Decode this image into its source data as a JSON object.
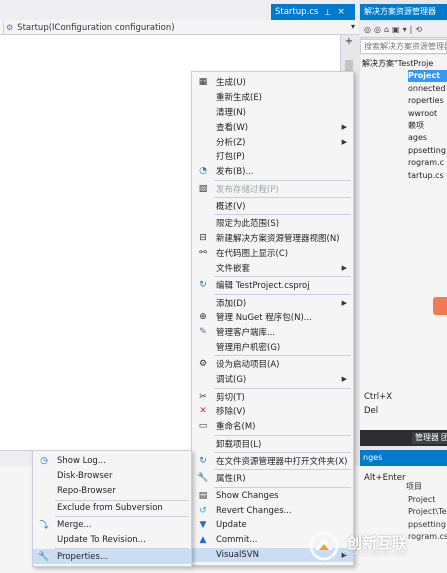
{
  "editor": {
    "tab_label": "Startup.cs",
    "tab_pin": "⊥",
    "tab_close": "×",
    "tab_dropdown": "▾",
    "method_icon": "⚙",
    "method_combo": "Startup(IConfiguration configuration)",
    "split_button": "+"
  },
  "solution_explorer": {
    "title": "解决方案资源管理器",
    "toolbar_icons": [
      "◎",
      "◎",
      "⌂",
      "▣",
      "▾",
      "|",
      "⟲"
    ],
    "search_placeholder": "搜索解决方案资源管理器",
    "items": [
      {
        "label": "解决方案\"TestProje",
        "selected": false
      },
      {
        "label": "Project",
        "selected": true
      },
      {
        "label": "onnected",
        "selected": false
      },
      {
        "label": "roperties",
        "selected": false
      },
      {
        "label": "wwroot",
        "selected": false
      },
      {
        "label": "赖项",
        "selected": false
      },
      {
        "label": "ages",
        "selected": false
      },
      {
        "label": "ppsetting",
        "selected": false
      },
      {
        "label": "rogram.c",
        "selected": false
      },
      {
        "label": "tartup.cs",
        "selected": false
      }
    ],
    "bottom_tabs": [
      "管理器",
      "团"
    ],
    "changes_title": "nges",
    "changes_items": [
      "项目",
      "Project",
      "Project\\Te",
      "ppsetting",
      "rogram.cs"
    ]
  },
  "main_menu": {
    "items": [
      {
        "icon": "▦",
        "icon_name": "build-icon",
        "label": "生成(U)",
        "shortcut": "",
        "arrow": false,
        "disabled": false
      },
      {
        "icon": "",
        "icon_name": "",
        "label": "重新生成(E)",
        "shortcut": "",
        "arrow": false,
        "disabled": false
      },
      {
        "icon": "",
        "icon_name": "",
        "label": "清理(N)",
        "shortcut": "",
        "arrow": false,
        "disabled": false
      },
      {
        "icon": "",
        "icon_name": "",
        "label": "查看(W)",
        "shortcut": "",
        "arrow": true,
        "disabled": false
      },
      {
        "icon": "",
        "icon_name": "",
        "label": "分析(Z)",
        "shortcut": "",
        "arrow": true,
        "disabled": false
      },
      {
        "icon": "",
        "icon_name": "",
        "label": "打包(P)",
        "shortcut": "",
        "arrow": false,
        "disabled": false
      },
      {
        "icon": "◔",
        "icon_name": "publish-icon",
        "label": "发布(B)...",
        "shortcut": "",
        "arrow": false,
        "disabled": false
      },
      {
        "sep": true
      },
      {
        "icon": "▧",
        "icon_name": "publish-stored-procedure-icon",
        "label": "发布存储过程(P)",
        "shortcut": "",
        "arrow": false,
        "disabled": true
      },
      {
        "sep": true
      },
      {
        "icon": "",
        "icon_name": "",
        "label": "概述(V)",
        "shortcut": "",
        "arrow": false,
        "disabled": false
      },
      {
        "sep": true
      },
      {
        "icon": "",
        "icon_name": "",
        "label": "限定为此范围(S)",
        "shortcut": "",
        "arrow": false,
        "disabled": false
      },
      {
        "icon": "⊟",
        "icon_name": "new-view-icon",
        "label": "新建解决方案资源管理器视图(N)",
        "shortcut": "",
        "arrow": false,
        "disabled": false
      },
      {
        "icon": "⚯",
        "icon_name": "code-map-icon",
        "label": "在代码图上显示(C)",
        "shortcut": "",
        "arrow": false,
        "disabled": false
      },
      {
        "icon": "",
        "icon_name": "",
        "label": "文件嵌套",
        "shortcut": "",
        "arrow": true,
        "disabled": false
      },
      {
        "sep": true
      },
      {
        "icon": "↻",
        "icon_name": "edit-project-icon",
        "label": "编辑 TestProject.csproj",
        "shortcut": "",
        "arrow": false,
        "disabled": false
      },
      {
        "sep": true
      },
      {
        "icon": "",
        "icon_name": "",
        "label": "添加(D)",
        "shortcut": "",
        "arrow": true,
        "disabled": false
      },
      {
        "icon": "⊕",
        "icon_name": "nuget-icon",
        "label": "管理 NuGet 程序包(N)...",
        "shortcut": "",
        "arrow": false,
        "disabled": false
      },
      {
        "icon": "✎",
        "icon_name": "client-library-icon",
        "label": "管理客户端库...",
        "shortcut": "",
        "arrow": false,
        "disabled": false
      },
      {
        "icon": "",
        "icon_name": "",
        "label": "管理用户机密(G)",
        "shortcut": "",
        "arrow": false,
        "disabled": false
      },
      {
        "sep": true
      },
      {
        "icon": "⚙",
        "icon_name": "startup-project-icon",
        "label": "设为启动项目(A)",
        "shortcut": "",
        "arrow": false,
        "disabled": false
      },
      {
        "icon": "",
        "icon_name": "",
        "label": "调试(G)",
        "shortcut": "",
        "arrow": true,
        "disabled": false
      },
      {
        "sep": true
      },
      {
        "icon": "✂",
        "icon_name": "cut-icon",
        "label": "剪切(T)",
        "shortcut": "Ctrl+X",
        "arrow": false,
        "disabled": false
      },
      {
        "icon": "✕",
        "icon_name": "remove-icon",
        "label": "移除(V)",
        "shortcut": "Del",
        "arrow": false,
        "disabled": false
      },
      {
        "icon": "▭",
        "icon_name": "rename-icon",
        "label": "重命名(M)",
        "shortcut": "",
        "arrow": false,
        "disabled": false
      },
      {
        "sep": true
      },
      {
        "icon": "",
        "icon_name": "",
        "label": "卸载项目(L)",
        "shortcut": "",
        "arrow": false,
        "disabled": false
      },
      {
        "sep": true
      },
      {
        "icon": "↻",
        "icon_name": "open-folder-icon",
        "label": "在文件资源管理器中打开文件夹(X)",
        "shortcut": "",
        "arrow": false,
        "disabled": false
      },
      {
        "sep": true
      },
      {
        "icon": "🔧",
        "icon_name": "properties-wrench-icon",
        "label": "属性(R)",
        "shortcut": "Alt+Enter",
        "arrow": false,
        "disabled": false
      },
      {
        "sep": true
      },
      {
        "icon": "▤",
        "icon_name": "show-changes-icon",
        "label": "Show Changes",
        "shortcut": "",
        "arrow": false,
        "disabled": false
      },
      {
        "icon": "↺",
        "icon_name": "revert-changes-icon",
        "label": "Revert Changes...",
        "shortcut": "",
        "arrow": false,
        "disabled": false
      },
      {
        "icon": "▼",
        "icon_name": "update-icon",
        "label": "Update",
        "shortcut": "",
        "arrow": false,
        "disabled": false
      },
      {
        "icon": "▲",
        "icon_name": "commit-icon",
        "label": "Commit...",
        "shortcut": "",
        "arrow": false,
        "disabled": false
      },
      {
        "icon": "",
        "icon_name": "",
        "label": "VisualSVN",
        "shortcut": "",
        "arrow": true,
        "disabled": false,
        "highlighted": true
      }
    ]
  },
  "sub_menu": {
    "items": [
      {
        "icon": "◷",
        "icon_name": "show-log-icon",
        "label": "Show Log..."
      },
      {
        "icon": "",
        "icon_name": "",
        "label": "Disk-Browser"
      },
      {
        "icon": "",
        "icon_name": "",
        "label": "Repo-Browser"
      },
      {
        "sep": true
      },
      {
        "icon": "",
        "icon_name": "",
        "label": "Exclude from Subversion"
      },
      {
        "sep": true
      },
      {
        "icon": "⤵",
        "icon_name": "merge-icon",
        "label": "Merge..."
      },
      {
        "icon": "",
        "icon_name": "",
        "label": "Update To Revision..."
      },
      {
        "sep": true
      },
      {
        "icon": "🔧",
        "icon_name": "properties-icon",
        "label": "Properties...",
        "highlighted": true
      }
    ]
  },
  "watermark": {
    "text": "创新互联",
    "subtext": "CHUANG XIN HU LIAN"
  }
}
